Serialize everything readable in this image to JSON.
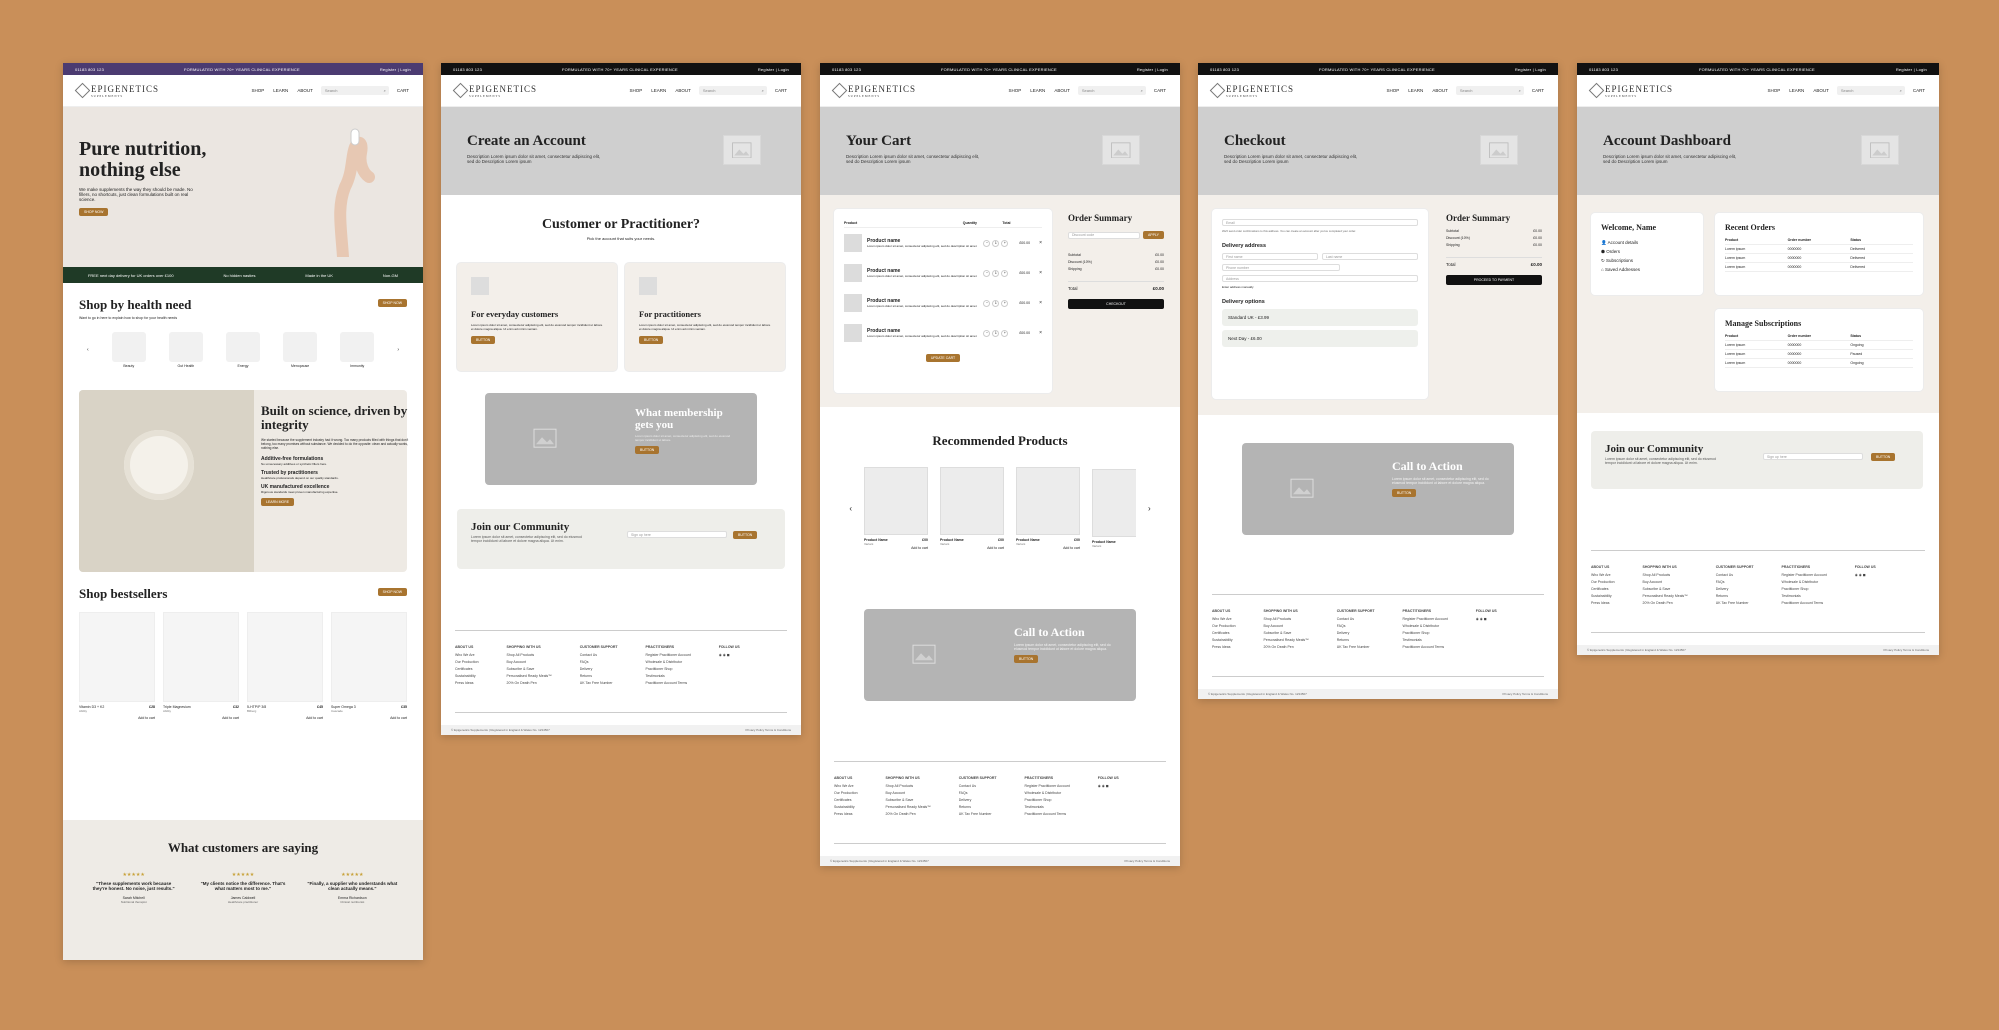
{
  "common": {
    "phone": "01183 803 123",
    "tagline": "FORMULATED WITH 70+ YEARS CLINICAL EXPERIENCE",
    "account_links": "Register | Login",
    "brand": "EPIGENETICS",
    "brand_sub": "SUPPLEMENTS",
    "nav": [
      "SHOP",
      "LEARN",
      "ABOUT"
    ],
    "search_placeholder": "Search",
    "cart": "CART",
    "community_title": "Join our Community",
    "community_text": "Lorem ipsum dolor sit amet, consectetur adipiscing elit, sed do eiusmod tempor incididunt ut labore et dolore magna aliqua. Ut enim.",
    "email_placeholder": "Sign up here",
    "email_note": "Lorem ipsum dolor sit amet consectetur adipiscing elit",
    "button": "BUTTON",
    "footer_cols": [
      {
        "title": "ABOUT US",
        "items": [
          "Who We Are",
          "Our Production",
          "Certificates",
          "Sustainability",
          "Press Ideas"
        ]
      },
      {
        "title": "SHOPPING WITH US",
        "items": [
          "Shop All Products",
          "Buy Account",
          "Subscribe & Save",
          "Personalised Ready Meals™",
          "20% On Death Pen"
        ]
      },
      {
        "title": "CUSTOMER SUPPORT",
        "items": [
          "Contact Us",
          "FAQs",
          "Delivery",
          "Returns",
          "UK Tax Free Number"
        ]
      },
      {
        "title": "PRACTITIONERS",
        "items": [
          "Register Practitioner Account",
          "Wholesale & Distributor",
          "Practitioner Shop",
          "Testimonials",
          "Practitioner Account Terms"
        ]
      },
      {
        "title": "FOLLOW US",
        "items": []
      }
    ],
    "copyright": "© Epigenetics Supplements  |  Registered in England & Wales No. 1234567",
    "legal": "Privacy Policy   Terms & Conditions",
    "colors": {
      "background": "#c98f59",
      "accent": "#a8742f",
      "topbar_home": "#4b3b71",
      "topbar": "#111111",
      "trust_bar": "#1f3a26"
    }
  },
  "home": {
    "hero_title": "Pure nutrition, nothing else",
    "hero_text": "We make supplements the way they should be made. No fillers, no shortcuts, just clean formulations built on real science.",
    "hero_button": "SHOP NOW",
    "trust": [
      "FREE next day delivery for UK orders over £100",
      "No hidden nasties",
      "Made in the UK",
      "Non-GM"
    ],
    "health_title": "Shop by health need",
    "health_sub": "Want to go in here to explain how to shop for your health needs",
    "health_button": "SHOP NOW",
    "health_needs": [
      "Beauty",
      "Gut Health",
      "Energy",
      "Menopause",
      "Immunity"
    ],
    "science_title": "Built on science, driven by integrity",
    "science_text": "We started because the supplement industry had it wrong. Too many products filled with things that don't belong, too many promises without substance. We decided to do the opposite: clean and actually works, nothing else.",
    "science_points": [
      {
        "title": "Additive-free formulations",
        "text": "No unnecessary additives or synthetic fillers here."
      },
      {
        "title": "Trusted by practitioners",
        "text": "Healthcare professionals depend on our quality standards."
      },
      {
        "title": "UK manufactured excellence",
        "text": "Rigorous standards meet proven manufacturing expertise."
      }
    ],
    "science_button": "LEARN MORE",
    "bestsellers_title": "Shop bestsellers",
    "bestsellers_button": "SHOP NOW",
    "products": [
      {
        "name": "Vitamin D3 + K2",
        "sub": "Ability",
        "price": "£28"
      },
      {
        "name": "Triple Magnesium",
        "sub": "Ability",
        "price": "£32"
      },
      {
        "name": "5-HTP/P 3/8",
        "sub": "Bilberg",
        "price": "£45"
      },
      {
        "name": "Super Omega 3",
        "sub": "Cascade",
        "price": "£35"
      }
    ],
    "add_to_cart": "Add to cart",
    "testimonials_title": "What customers are saying",
    "testimonials": [
      {
        "quote": "\"These supplements work because they're honest. No noise, just results.\"",
        "name": "Sarah Mitchell",
        "role": "Nutritional therapist"
      },
      {
        "quote": "\"My clients notice the difference. That's what matters most to me.\"",
        "name": "James Caldwell",
        "role": "Healthcare practitioner"
      },
      {
        "quote": "\"Finally, a supplier who understands what clean actually means.\"",
        "name": "Emma Richardson",
        "role": "Clinical nutritionist"
      }
    ]
  },
  "account": {
    "title": "Create an Account",
    "description": "Description Lorem ipsum dolor sit amet, consectetur adipiscing elit, sed do Description Lorem ipsum",
    "question": "Customer or Practitioner?",
    "question_sub": "Pick the account that suits your needs.",
    "options": [
      {
        "title": "For everyday customers",
        "text": "Lorem ipsum dolor sit amet, consectetur adipiscing elit, sed do eiusmod tempor incididunt ut labore et dolore magna aliqua. Ut enim ad minim veniam.",
        "button": "BUTTON"
      },
      {
        "title": "For practitioners",
        "text": "Lorem ipsum dolor sit amet, consectetur adipiscing elit, sed do eiusmod tempor incididunt ut labore et dolore magna aliqua. Ut enim ad minim veniam.",
        "button": "BUTTON"
      }
    ],
    "membership_title": "What membership gets you",
    "membership_text": "Lorem ipsum dolor sit amet, consectetur adipiscing elit, sed do eiusmod tempor incididunt ut labore."
  },
  "cart": {
    "title": "Your Cart",
    "description": "Description Lorem ipsum dolor sit amet, consectetur adipiscing elit, sed do Description Lorem ipsum",
    "headers": [
      "Product",
      "Quantity",
      "Total"
    ],
    "items": [
      {
        "name": "Product name",
        "desc": "Lorem ipsum dolor sit amet, consectetur adipiscing elit, sed do description sit amet",
        "qty": "1",
        "total": "£00.00"
      },
      {
        "name": "Product name",
        "desc": "Lorem ipsum dolor sit amet, consectetur adipiscing elit, sed do description sit amet",
        "qty": "1",
        "total": "£00.00"
      },
      {
        "name": "Product name",
        "desc": "Lorem ipsum dolor sit amet, consectetur adipiscing elit, sed do description sit amet",
        "qty": "1",
        "total": "£00.00"
      },
      {
        "name": "Product name",
        "desc": "Lorem ipsum dolor sit amet, consectetur adipiscing elit, sed do description sit amet",
        "qty": "1",
        "total": "£00.00"
      }
    ],
    "update_button": "UPDATE CART",
    "summary_title": "Order Summary",
    "discount_placeholder": "Discount code",
    "apply": "APPLY",
    "summary_rows": [
      [
        "Subtotal",
        "£0.00"
      ],
      [
        "Discount (10%)",
        "£0.00"
      ],
      [
        "Shipping",
        "£0.00"
      ]
    ],
    "total_label": "Total",
    "total_value": "£0.00",
    "checkout_button": "CHECKOUT",
    "recommended_title": "Recommended Products",
    "rec_products": [
      {
        "name": "Product Name",
        "sub": "Variant",
        "price": "£00"
      },
      {
        "name": "Product Name",
        "sub": "Variant",
        "price": "£00"
      },
      {
        "name": "Product Name",
        "sub": "Variant",
        "price": "£00"
      },
      {
        "name": "Product Name",
        "sub": "Variant",
        "price": "£00"
      }
    ],
    "cta_title": "Call to Action",
    "cta_text": "Lorem ipsum dolor sit amet, consectetur adipiscing elit, sed do eiusmod tempor incididunt ut labore et dolore magna aliqua."
  },
  "checkout": {
    "title": "Checkout",
    "description": "Description Lorem ipsum dolor sit amet, consectetur adipiscing elit, sed do Description Lorem ipsum",
    "email_placeholder": "Email",
    "email_note": "We'll send order confirmations to this address. You can create an account after you've completed your order.",
    "delivery_title": "Delivery address",
    "fields": [
      "First name",
      "Last name",
      "Phone number",
      "Address"
    ],
    "manual_link": "Enter address manually",
    "options_title": "Delivery options",
    "options": [
      "Standard UK - £3.99",
      "Next Day - £6.00"
    ],
    "summary_title": "Order Summary",
    "summary_rows": [
      [
        "Subtotal",
        "£0.00"
      ],
      [
        "Discount (10%)",
        "£0.00"
      ],
      [
        "Shipping",
        "£0.00"
      ]
    ],
    "total_label": "Total",
    "total_value": "£0.00",
    "pay_button": "PROCEED TO PAYMENT",
    "cta_title": "Call to Action",
    "cta_text": "Lorem ipsum dolor sit amet, consectetur adipiscing elit, sed do eiusmod tempor incididunt ut labore et dolore magna aliqua."
  },
  "dashboard": {
    "title": "Account Dashboard",
    "description": "Description Lorem ipsum dolor sit amet, consectetur adipiscing elit, sed do Description Lorem ipsum",
    "welcome": "Welcome, Name",
    "menu": [
      "Account details",
      "Orders",
      "Subscriptions",
      "Saved Addresses"
    ],
    "orders_title": "Recent Orders",
    "orders_headers": [
      "Product",
      "Order number",
      "Status"
    ],
    "orders": [
      [
        "Lorem ipsum",
        "0000000",
        "Delivered"
      ],
      [
        "Lorem ipsum",
        "0000000",
        "Delivered"
      ],
      [
        "Lorem ipsum",
        "0000000",
        "Delivered"
      ]
    ],
    "subs_title": "Manage Subscriptions",
    "subs_headers": [
      "Product",
      "Order number",
      "Status"
    ],
    "subs": [
      [
        "Lorem ipsum",
        "0000000",
        "Ongoing"
      ],
      [
        "Lorem ipsum",
        "0000000",
        "Paused"
      ],
      [
        "Lorem ipsum",
        "0000000",
        "Ongoing"
      ]
    ]
  }
}
